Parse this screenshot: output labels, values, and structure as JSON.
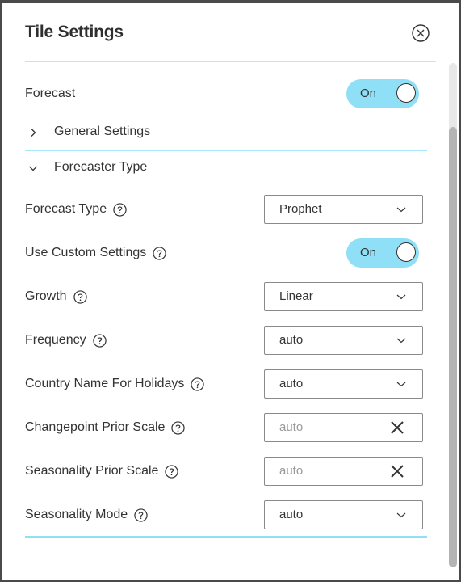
{
  "dialog": {
    "title": "Tile Settings",
    "close_icon": "circle-x-icon"
  },
  "forecast": {
    "label": "Forecast",
    "toggle_text": "On",
    "enabled": true
  },
  "sections": [
    {
      "label": "General Settings",
      "expanded": false,
      "icon": "chevron-right-icon"
    },
    {
      "label": "Forecaster Type",
      "expanded": true,
      "icon": "chevron-down-icon"
    }
  ],
  "fields": {
    "forecast_type": {
      "label": "Forecast Type",
      "value": "Prophet",
      "kind": "select"
    },
    "use_custom_settings": {
      "label": "Use Custom Settings",
      "toggle_text": "On",
      "enabled": true
    },
    "growth": {
      "label": "Growth",
      "value": "Linear",
      "kind": "select"
    },
    "frequency": {
      "label": "Frequency",
      "value": "auto",
      "kind": "select"
    },
    "country_name_for_holidays": {
      "label": "Country Name For Holidays",
      "value": "auto",
      "kind": "select"
    },
    "changepoint_prior_scale": {
      "label": "Changepoint Prior Scale",
      "placeholder": "auto",
      "kind": "text"
    },
    "seasonality_prior_scale": {
      "label": "Seasonality Prior Scale",
      "placeholder": "auto",
      "kind": "text"
    },
    "seasonality_mode": {
      "label": "Seasonality Mode",
      "value": "auto",
      "kind": "select"
    }
  },
  "colors": {
    "accent": "#8fdff6",
    "divider": "#a6e6f8",
    "text": "#333333"
  }
}
